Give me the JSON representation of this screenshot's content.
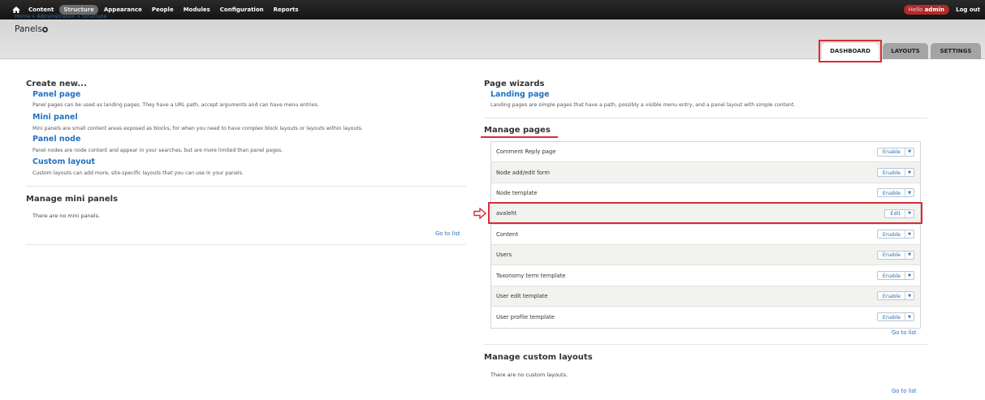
{
  "toolbar": {
    "items": [
      "Content",
      "Structure",
      "Appearance",
      "People",
      "Modules",
      "Configuration",
      "Reports"
    ],
    "active_index": 1,
    "hello_prefix": "Hello",
    "hello_user": "admin",
    "logout": "Log out"
  },
  "header": {
    "breadcrumb": "Home » Administration » Structure",
    "title": "Panels"
  },
  "tabs": [
    "DASHBOARD",
    "LAYOUTS",
    "SETTINGS"
  ],
  "left": {
    "create_title": "Create new...",
    "create_items": [
      {
        "link": "Panel page",
        "desc": "Panel pages can be used as landing pages. They have a URL path, accept arguments and can have menu entries."
      },
      {
        "link": "Mini panel",
        "desc": "Mini panels are small content areas exposed as blocks, for when you need to have complex block layouts or layouts within layouts."
      },
      {
        "link": "Panel node",
        "desc": "Panel nodes are node content and appear in your searches, but are more limited than panel pages."
      },
      {
        "link": "Custom layout",
        "desc": "Custom layouts can add more, site-specific layouts that you can use in your panels."
      }
    ],
    "mini_title": "Manage mini panels",
    "mini_empty": "There are no mini panels.",
    "goto": "Go to list"
  },
  "right": {
    "wizards_title": "Page wizards",
    "landing_link": "Landing page",
    "landing_desc": "Landing pages are simple pages that have a path, possibly a visible menu entry, and a panel layout with simple content.",
    "pages_title": "Manage pages",
    "pages": [
      {
        "name": "Comment Reply page",
        "action": "Enable"
      },
      {
        "name": "Node add/edit form",
        "action": "Enable"
      },
      {
        "name": "Node template",
        "action": "Enable"
      },
      {
        "name": "avaleht",
        "action": "Edit"
      },
      {
        "name": "Content",
        "action": "Enable"
      },
      {
        "name": "Users",
        "action": "Enable"
      },
      {
        "name": "Taxonomy term template",
        "action": "Enable"
      },
      {
        "name": "User edit template",
        "action": "Enable"
      },
      {
        "name": "User profile template",
        "action": "Enable"
      }
    ],
    "goto": "Go to list",
    "custom_title": "Manage custom layouts",
    "custom_empty": "There are no custom layouts.",
    "goto2": "Go to list"
  },
  "colors": {
    "accent_red": "#d72c35",
    "link_blue": "#1f73c1",
    "toolbar_bg": "#1c1c1c"
  },
  "icons": {
    "home": "home-icon",
    "gear": "gear-icon",
    "arrow": "red-arrow-icon",
    "dropdown": "chevron-down-icon"
  }
}
